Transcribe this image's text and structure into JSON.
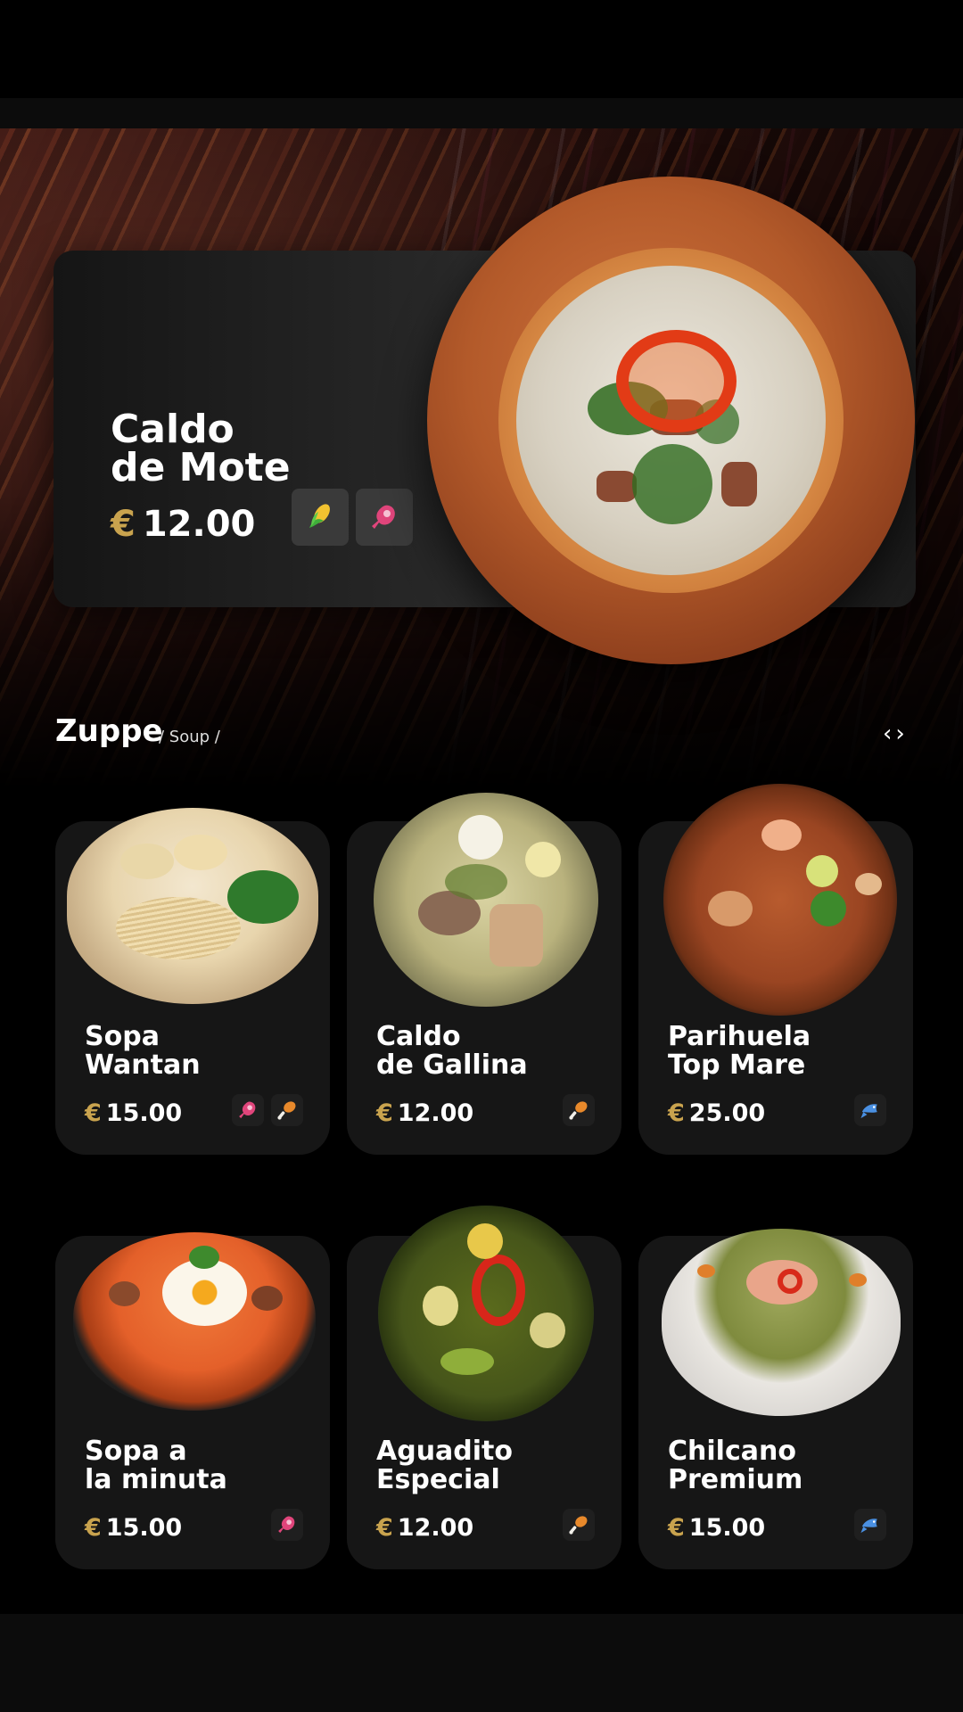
{
  "featured": {
    "title_line1": "Caldo",
    "title_line2": "de Mote",
    "currency": "€",
    "price": "12.00",
    "allergens": [
      "corn-icon",
      "meat-icon"
    ]
  },
  "section": {
    "title": "Zuppe",
    "subtitle": "/ Soup /",
    "prev": "‹",
    "next": "›"
  },
  "items": [
    {
      "line1": "Sopa",
      "line2": "Wantan",
      "currency": "€",
      "price": "15.00",
      "tags": [
        "meat-icon",
        "chicken-icon"
      ]
    },
    {
      "line1": "Caldo",
      "line2": "de Gallina",
      "currency": "€",
      "price": "12.00",
      "tags": [
        "chicken-icon"
      ]
    },
    {
      "line1": "Parihuela",
      "line2": "Top Mare",
      "currency": "€",
      "price": "25.00",
      "tags": [
        "fish-icon"
      ]
    },
    {
      "line1": "Sopa a",
      "line2": "la minuta",
      "currency": "€",
      "price": "15.00",
      "tags": [
        "meat-icon"
      ]
    },
    {
      "line1": "Aguadito",
      "line2": "Especial",
      "currency": "€",
      "price": "12.00",
      "tags": [
        "chicken-icon"
      ]
    },
    {
      "line1": "Chilcano",
      "line2": "Premium",
      "currency": "€",
      "price": "15.00",
      "tags": [
        "fish-icon"
      ]
    }
  ],
  "colors": {
    "accent_gold": "#c9a34e",
    "card_bg": "#161616",
    "meat_pink": "#e0457b",
    "chicken_orange": "#e8892b",
    "fish_blue": "#4a90e2"
  }
}
